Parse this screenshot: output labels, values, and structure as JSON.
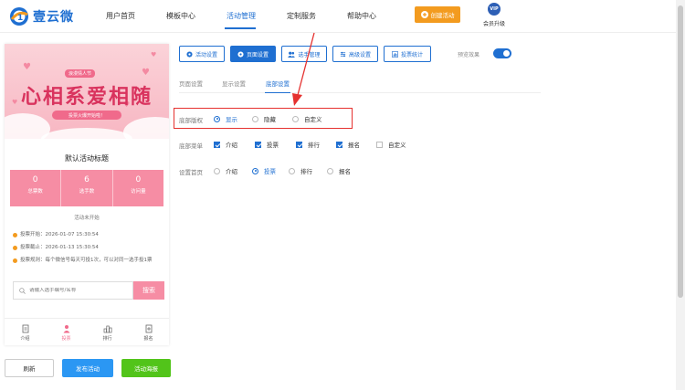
{
  "brand": {
    "name": "壹云微",
    "accent": "#1f6fd1"
  },
  "nav": {
    "items": [
      {
        "label": "用户首页"
      },
      {
        "label": "模板中心"
      },
      {
        "label": "活动管理",
        "active": true
      },
      {
        "label": "定制服务"
      },
      {
        "label": "帮助中心"
      }
    ],
    "create_button": "创建活动",
    "vip_badge": "VIP",
    "vip_label": "会员升级"
  },
  "preview": {
    "banner_small": "浪漫情人节",
    "banner_title": "心相系爱相随",
    "banner_cta": "投票火爆开始啦！",
    "activity_title": "默认活动标题",
    "stats": [
      {
        "value": "0",
        "label": "总票数"
      },
      {
        "value": "6",
        "label": "选手数"
      },
      {
        "value": "0",
        "label": "访问量"
      }
    ],
    "status": "活动未开始",
    "vote_start": "投票开始：2026-01-07 15:30:54",
    "vote_end": "投票截止：2026-01-13 15:30:54",
    "vote_rule": "投票规则：每个微信号每天可投1次，可以对同一选手投1票",
    "search_placeholder": "请输入选手编号/名称",
    "search_button": "搜索",
    "tabbar": [
      {
        "label": "介绍"
      },
      {
        "label": "投票",
        "active": true
      },
      {
        "label": "排行"
      },
      {
        "label": "报名"
      }
    ]
  },
  "actions": {
    "refresh": "刷新",
    "publish": "发布活动",
    "poster": "活动海报"
  },
  "settings": {
    "tabs": [
      {
        "label": "活动设置"
      },
      {
        "label": "页面设置",
        "active": true
      },
      {
        "label": "选手管理"
      },
      {
        "label": "高级设置"
      },
      {
        "label": "投票统计"
      }
    ],
    "preview_label": "预览效果",
    "preview_on": true,
    "sub_tabs": [
      {
        "label": "页面设置"
      },
      {
        "label": "显示设置"
      },
      {
        "label": "底部设置",
        "active": true
      }
    ],
    "copyright": {
      "label": "底部版权",
      "options": [
        {
          "label": "显示",
          "selected": true
        },
        {
          "label": "隐藏"
        },
        {
          "label": "自定义"
        }
      ]
    },
    "bottom_menu": {
      "label": "底部菜单",
      "options": [
        {
          "label": "介绍",
          "checked": true
        },
        {
          "label": "投票",
          "checked": true
        },
        {
          "label": "排行",
          "checked": true
        },
        {
          "label": "报名",
          "checked": true
        },
        {
          "label": "自定义",
          "checked": false
        }
      ]
    },
    "home_page": {
      "label": "设置首页",
      "options": [
        {
          "label": "介绍"
        },
        {
          "label": "投票",
          "selected": true
        },
        {
          "label": "排行"
        },
        {
          "label": "报名"
        }
      ]
    }
  }
}
